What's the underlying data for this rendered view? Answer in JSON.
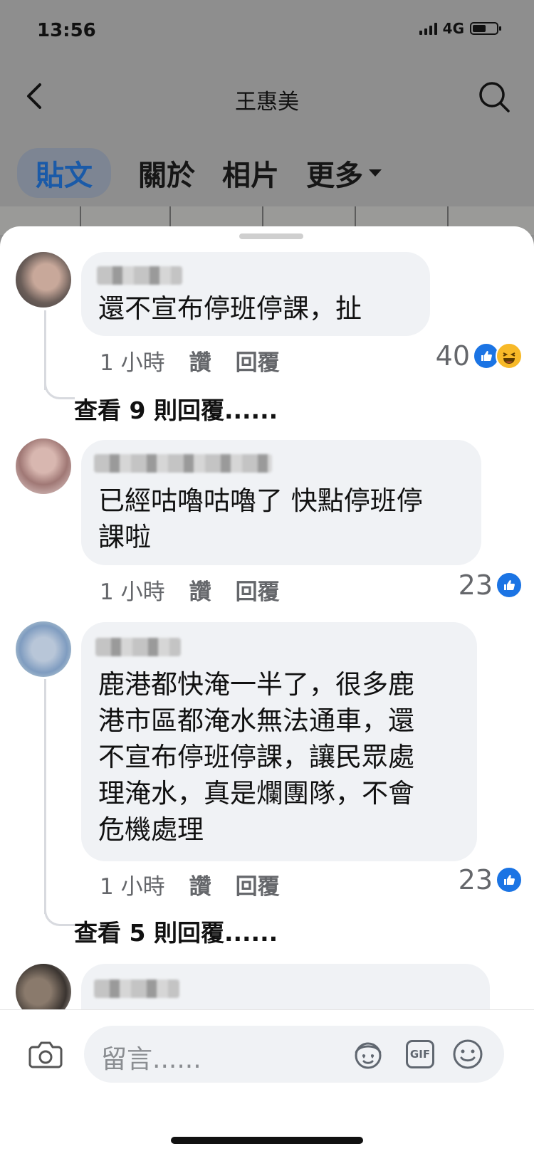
{
  "status": {
    "time": "13:56",
    "network": "4G"
  },
  "header": {
    "title": "王惠美"
  },
  "tabs": [
    {
      "label": "貼文"
    },
    {
      "label": "關於"
    },
    {
      "label": "相片"
    },
    {
      "label": "更多"
    }
  ],
  "comments": [
    {
      "text": "還不宣布停班停課，扯",
      "time": "1 小時",
      "like": "讚",
      "reply": "回覆",
      "count": "40",
      "reactions": [
        "like-icon",
        "haha-icon"
      ],
      "more_replies": "查看 9 則回覆......"
    },
    {
      "text_lines": [
        "已經咕嚕咕嚕了 快點停班停",
        "課啦"
      ],
      "time": "1 小時",
      "like": "讚",
      "reply": "回覆",
      "count": "23",
      "reactions": [
        "like-icon"
      ]
    },
    {
      "text_lines": [
        "鹿港都快淹一半了，很多鹿",
        "港市區都淹水無法通車，還",
        "不宣布停班停課，讓民眾處",
        "理淹水，真是爛團隊，不會",
        "危機處理"
      ],
      "time": "1 小時",
      "like": "讚",
      "reply": "回覆",
      "count": "23",
      "reactions": [
        "like-icon"
      ],
      "more_replies": "查看 5 則回覆......"
    }
  ],
  "composer": {
    "placeholder": "留言......",
    "gif": "GIF"
  },
  "colors": {
    "brand": "#1b74e4",
    "bubble": "#f0f2f5"
  }
}
